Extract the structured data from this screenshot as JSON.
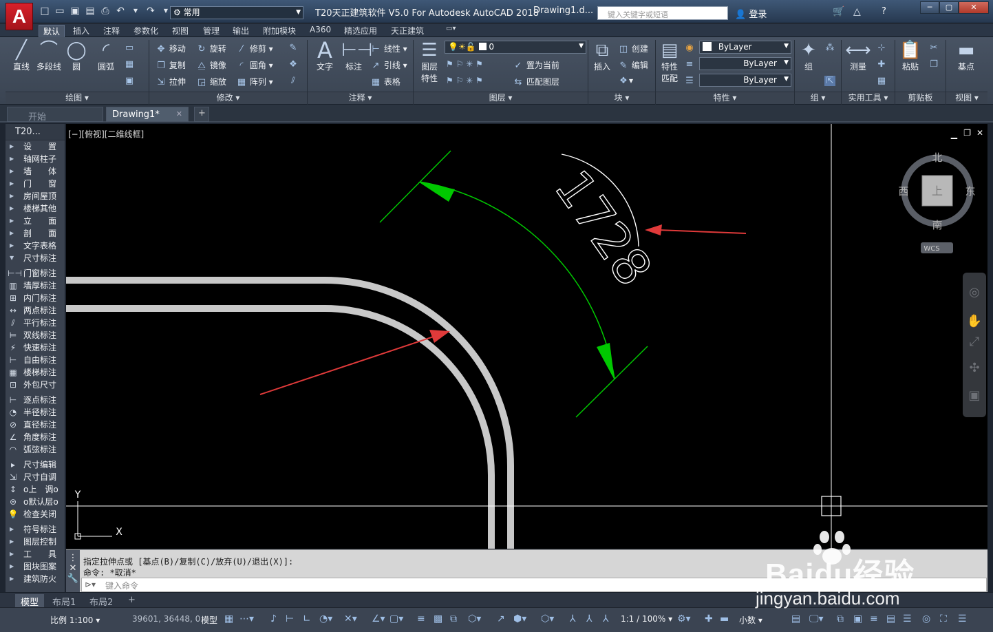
{
  "window": {
    "app_title": "T20天正建筑软件 V5.0 For Autodesk AutoCAD 2018",
    "doc_title": "Drawing1.d...",
    "logo": "A"
  },
  "quick_access": {
    "workspace": "常用",
    "search_placeholder": "键入关键字或短语",
    "login": "登录"
  },
  "ribbon_tabs": [
    "默认",
    "插入",
    "注释",
    "参数化",
    "视图",
    "管理",
    "输出",
    "附加模块",
    "A360",
    "精选应用",
    "天正建筑"
  ],
  "ribbon": {
    "draw": {
      "line": "直线",
      "polyline": "多段线",
      "circle": "圆",
      "arc": "圆弧",
      "panel": "绘图"
    },
    "modify": {
      "move": "移动",
      "rotate": "旋转",
      "trim": "修剪",
      "copy": "复制",
      "mirror": "镜像",
      "fillet": "圆角",
      "stretch": "拉伸",
      "scale": "缩放",
      "array": "阵列",
      "panel": "修改"
    },
    "annotation": {
      "text": "文字",
      "dimension": "标注",
      "linear": "线性",
      "leader": "引线",
      "table": "表格",
      "panel": "注释"
    },
    "layers": {
      "properties_l1": "图层",
      "properties_l2": "特性",
      "current_layer": "0",
      "set_current": "置为当前",
      "match_layer": "匹配图层",
      "panel": "图层"
    },
    "block": {
      "insert": "插入",
      "create": "创建",
      "edit": "编辑",
      "panel": "块"
    },
    "properties": {
      "match_l1": "特性",
      "match_l2": "匹配",
      "color": "ByLayer",
      "linetype": "ByLayer",
      "lineweight": "ByLayer",
      "panel": "特性"
    },
    "groups": {
      "group": "组",
      "panel": "组"
    },
    "utilities": {
      "measure": "测量",
      "panel": "实用工具"
    },
    "clipboard": {
      "paste": "粘贴",
      "panel": "剪贴板"
    },
    "view": {
      "base": "基点",
      "panel": "视图"
    }
  },
  "doc_tabs": {
    "start": "开始",
    "drawing": "Drawing1*"
  },
  "left_panel": {
    "title": "T20...",
    "menu": [
      "设　　置",
      "轴网柱子",
      "墙　　体",
      "门　　窗",
      "房间屋顶",
      "楼梯其他",
      "立　　面",
      "剖　　面",
      "文字表格",
      "尺寸标注"
    ],
    "dim_tools_1": [
      "门窗标注",
      "墙厚标注",
      "内门标注",
      "两点标注",
      "平行标注",
      "双线标注",
      "快速标注",
      "自由标注",
      "楼梯标注",
      "外包尺寸"
    ],
    "dim_tools_2": [
      "逐点标注",
      "半径标注",
      "直径标注",
      "角度标注",
      "弧弦标注"
    ],
    "dim_tools_3": [
      "尺寸编辑",
      "尺寸自调",
      "o上　调o",
      "o默认层o",
      "检查关闭"
    ],
    "more": [
      "符号标注",
      "图层控制",
      "工　　具",
      "图块图案",
      "建筑防火"
    ]
  },
  "viewport": {
    "label": "[−][俯视][二维线框]",
    "dimension_text": "1728",
    "ucs_x": "X",
    "ucs_y": "Y"
  },
  "viewcube": {
    "north": "北",
    "south": "南",
    "west": "西",
    "east": "东",
    "top": "上",
    "wcs": "WCS"
  },
  "command": {
    "line1": "指定拉伸点或 [基点(B)/复制(C)/放弃(U)/退出(X)]:",
    "line2": "命令: *取消*",
    "placeholder": "键入命令"
  },
  "layout_tabs": [
    "模型",
    "布局1",
    "布局2"
  ],
  "status": {
    "scale": "比例 1:100",
    "coords": "39601, 36448, 0",
    "model": "模型",
    "annotation_scale": "1:1 / 100%",
    "units": "小数"
  },
  "watermark": {
    "brand": "Baidu经验",
    "url": "jingyan.baidu.com"
  },
  "colors": {
    "dim_line": "#00c800",
    "arrow_red": "#e03a3a",
    "wall": "#c8c8c8",
    "canvas": "#000000",
    "ribbon": "#3f4a58"
  }
}
